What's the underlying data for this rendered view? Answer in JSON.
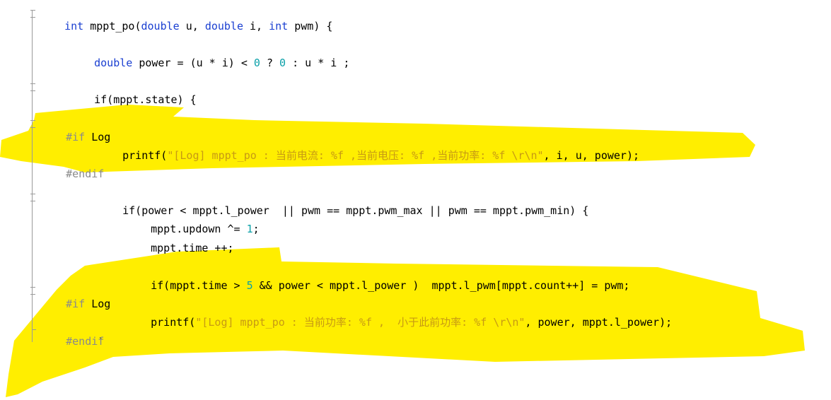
{
  "code": {
    "l1": {
      "kw1": "int",
      "t1": " mppt_po(",
      "kw2": "double",
      "t2": " u, ",
      "kw3": "double",
      "t3": " i, ",
      "kw4": "int",
      "t4": " pwm) {"
    },
    "l2": {
      "kw1": "double",
      "t1": " power = (u * i) < ",
      "n1": "0",
      "t2": " ? ",
      "n2": "0",
      "t3": " : u * i ;"
    },
    "l3": {
      "t1": "if(mppt.state) {"
    },
    "l4": {
      "pp": "#if",
      "name": " Log"
    },
    "l5": {
      "t1": "printf(",
      "s1": "\"[Log] mppt_po : 当前电流: %f ,当前电压: %f ,当前功率: %f \\r\\n\"",
      "t2": ", i, u, power);"
    },
    "l6": {
      "pp": "#endif"
    },
    "l7": {
      "t1": "if(power < mppt.l_power  || pwm == mppt.pwm_max || pwm == mppt.pwm_min) {"
    },
    "l8": {
      "t1": "mppt.updown ^= ",
      "n1": "1",
      "t2": ";"
    },
    "l9": {
      "t1": "mppt.time ++;"
    },
    "l10": {
      "t1": "if(mppt.time > ",
      "n1": "5",
      "t2": " && power < mppt.l_power )  mppt.l_pwm[mppt.count++] = pwm;"
    },
    "l11": {
      "pp": "#if",
      "name": " Log"
    },
    "l12": {
      "t1": "printf(",
      "s1": "\"[Log] mppt_po : 当前功率: %f ,  小于此前功率: %f \\r\\n\"",
      "t2": ", power, mppt.l_power);"
    },
    "l13": {
      "pp": "#endif"
    },
    "l14": {
      "t1": "`"
    }
  },
  "colors": {
    "keyword": "#1a3fd1",
    "number": "#0aa0a8",
    "string": "#c79a14",
    "preprocessor": "#8a8a8a",
    "highlight": "#ffee00"
  }
}
